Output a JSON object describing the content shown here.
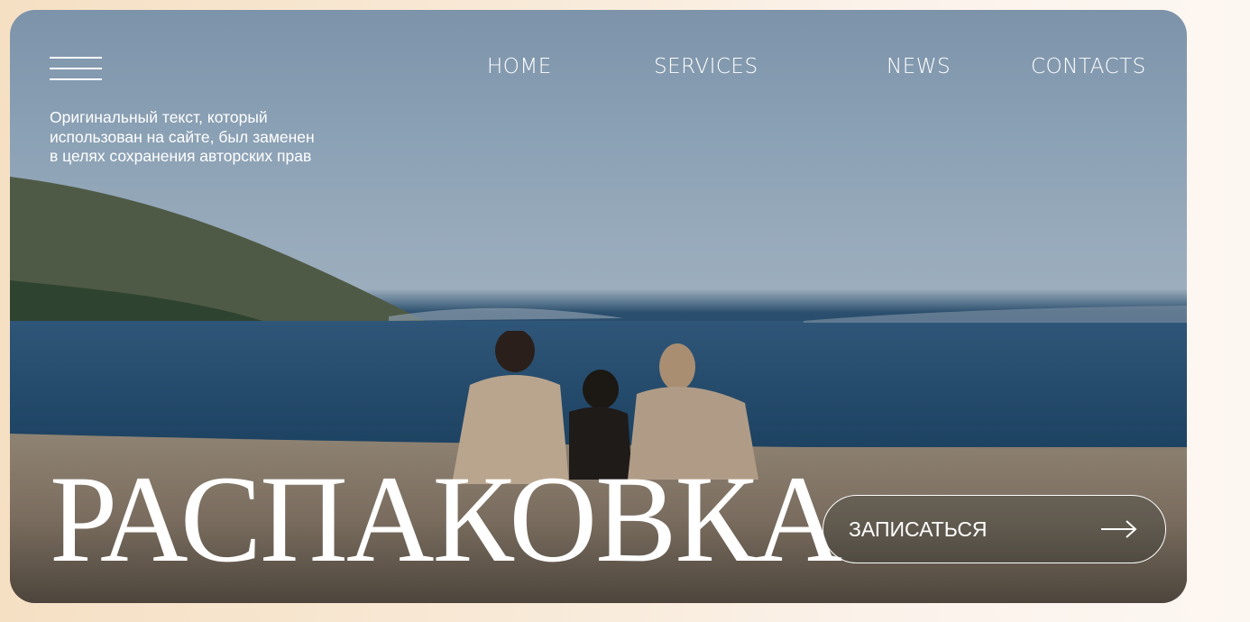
{
  "nav": {
    "menu_icon": "hamburger-icon",
    "links": [
      "HOME",
      "SERVICES",
      "NEWS",
      "CONTACTS"
    ]
  },
  "intro": {
    "lines": [
      "Оригинальный текст, который",
      "использован на сайте, был заменен",
      "в целях сохранения авторских прав"
    ]
  },
  "hero": {
    "headline": "РАСПАКОВКА",
    "cta_label": "ЗАПИСАТЬСЯ",
    "cta_icon": "arrow-right-icon"
  },
  "colors": {
    "text": "#ffffff",
    "page_bg": "#f8e9d6"
  }
}
